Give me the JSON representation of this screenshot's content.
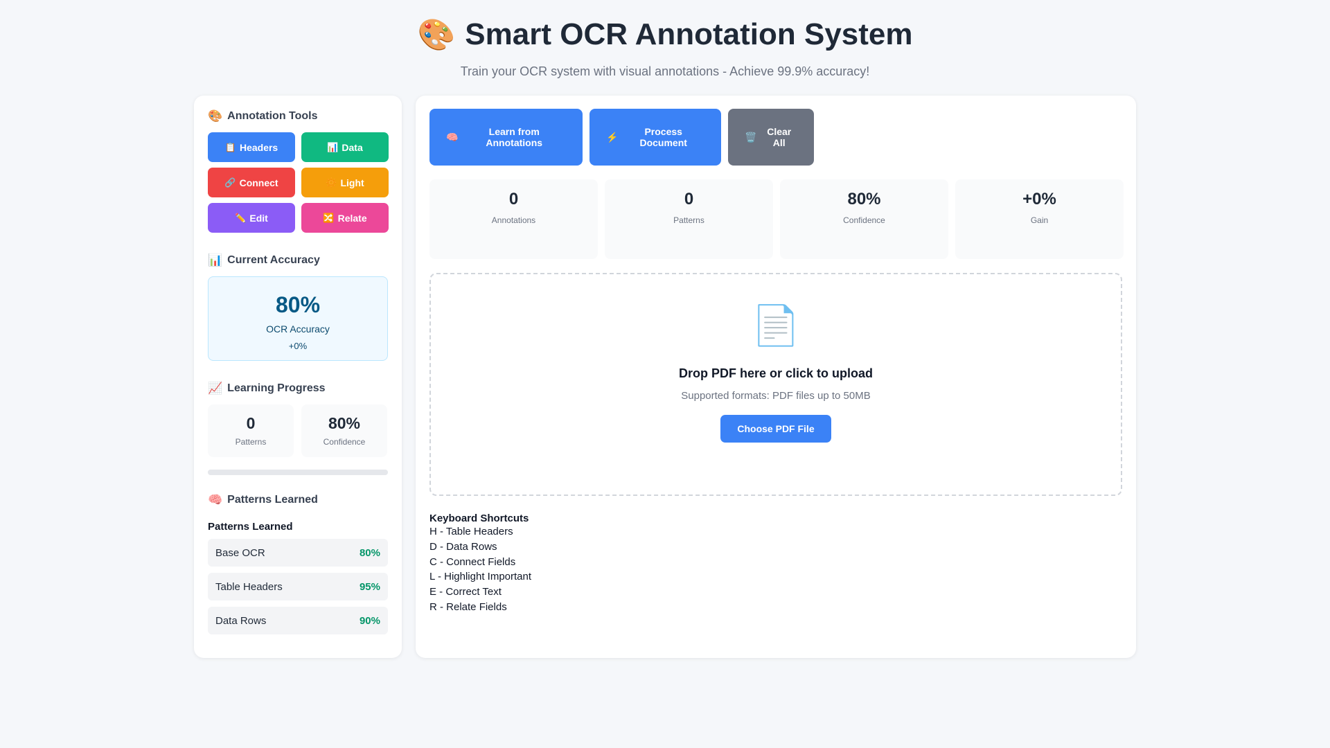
{
  "header": {
    "icon": "palette-emoji",
    "icon_glyph": "🎨",
    "title": "Smart OCR Annotation System",
    "subtitle": "Train your OCR system with visual annotations - Achieve 99.9% accuracy!"
  },
  "sidebar": {
    "tools_title": "Annotation Tools",
    "tools_icon": "🎨",
    "tools": [
      {
        "label": "Headers",
        "icon": "📋",
        "icon_name": "clipboard-icon",
        "color": "#3b82f6"
      },
      {
        "label": "Data",
        "icon": "📊",
        "icon_name": "bar-chart-icon",
        "color": "#10b981"
      },
      {
        "label": "Connect",
        "icon": "🔗",
        "icon_name": "link-icon",
        "color": "#ef4444"
      },
      {
        "label": "Light",
        "icon": "🔆",
        "icon_name": "sun-icon",
        "color": "#f59e0b"
      },
      {
        "label": "Edit",
        "icon": "✏️",
        "icon_name": "pencil-icon",
        "color": "#8b5cf6"
      },
      {
        "label": "Relate",
        "icon": "🔀",
        "icon_name": "shuffle-icon",
        "color": "#ec4899"
      }
    ],
    "accuracy": {
      "title": "Current Accuracy",
      "icon": "📊",
      "value": "80%",
      "label": "OCR Accuracy",
      "delta": "+0%"
    },
    "learning": {
      "title": "Learning Progress",
      "icon": "📈",
      "patterns_value": "0",
      "patterns_label": "Patterns",
      "confidence_value": "80%",
      "confidence_label": "Confidence",
      "progress_fraction": 0
    },
    "patterns": {
      "title": "Patterns Learned",
      "icon": "🧠",
      "subtitle": "Patterns Learned",
      "items": [
        {
          "name": "Base OCR",
          "value": "80%"
        },
        {
          "name": "Table Headers",
          "value": "95%"
        },
        {
          "name": "Data Rows",
          "value": "90%"
        }
      ]
    }
  },
  "main": {
    "actions": [
      {
        "label": "Learn from Annotations",
        "icon": "🧠",
        "icon_name": "brain-icon",
        "color": "#3b82f6"
      },
      {
        "label": "Process Document",
        "icon": "⚡",
        "icon_name": "lightning-icon",
        "color": "#3b82f6"
      },
      {
        "label": "Clear All",
        "icon": "🗑️",
        "icon_name": "trash-icon",
        "color": "#6b7280"
      }
    ],
    "stats": [
      {
        "value": "0",
        "label": "Annotations"
      },
      {
        "value": "0",
        "label": "Patterns"
      },
      {
        "value": "80%",
        "label": "Confidence"
      },
      {
        "value": "+0%",
        "label": "Gain"
      }
    ],
    "upload": {
      "icon": "📄",
      "title": "Drop PDF here or click to upload",
      "subtitle": "Supported formats: PDF files up to 50MB",
      "button_label": "Choose PDF File"
    },
    "shortcuts": {
      "title": "Keyboard Shortcuts",
      "items": [
        "H - Table Headers",
        "D - Data Rows",
        "C - Connect Fields",
        "L - Highlight Important",
        "E - Correct Text",
        "R - Relate Fields"
      ]
    }
  }
}
